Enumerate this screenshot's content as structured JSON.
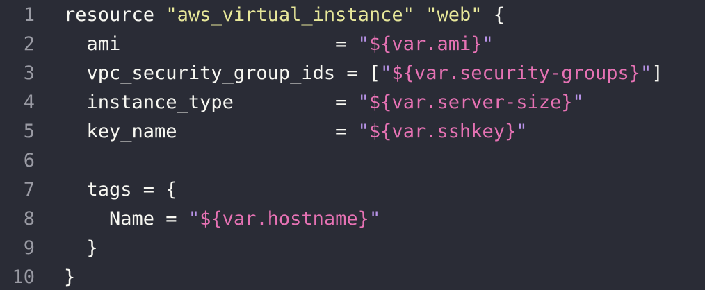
{
  "colors": {
    "background": "#2a2c36",
    "text": "#f8f8f2",
    "line_number": "#9a9ba4",
    "string": "#e8e89a",
    "quote": "#b893e8",
    "interpolation": "#e672b4"
  },
  "lines": [
    {
      "num": "1",
      "indent": "",
      "key": "resource ",
      "rest": [
        {
          "t": "\"aws_virtual_instance\"",
          "c": "s-str"
        },
        {
          "t": " ",
          "c": "s-plain"
        },
        {
          "t": "\"web\"",
          "c": "s-str"
        },
        {
          "t": " {",
          "c": "s-plain"
        }
      ]
    },
    {
      "num": "2",
      "indent": "  ",
      "key": "ami                   = ",
      "rest": [
        {
          "t": "\"",
          "c": "s-quote"
        },
        {
          "t": "${var.ami}",
          "c": "s-interp"
        },
        {
          "t": "\"",
          "c": "s-quote"
        }
      ]
    },
    {
      "num": "3",
      "indent": "  ",
      "key": "vpc_security_group_ids = [",
      "rest": [
        {
          "t": "\"",
          "c": "s-quote"
        },
        {
          "t": "${var.security-groups}",
          "c": "s-interp"
        },
        {
          "t": "\"",
          "c": "s-quote"
        },
        {
          "t": "]",
          "c": "s-plain"
        }
      ]
    },
    {
      "num": "4",
      "indent": "  ",
      "key": "instance_type         = ",
      "rest": [
        {
          "t": "\"",
          "c": "s-quote"
        },
        {
          "t": "${var.server-size}",
          "c": "s-interp"
        },
        {
          "t": "\"",
          "c": "s-quote"
        }
      ]
    },
    {
      "num": "5",
      "indent": "  ",
      "key": "key_name              = ",
      "rest": [
        {
          "t": "\"",
          "c": "s-quote"
        },
        {
          "t": "${var.sshkey}",
          "c": "s-interp"
        },
        {
          "t": "\"",
          "c": "s-quote"
        }
      ]
    },
    {
      "num": "6",
      "indent": "",
      "key": "",
      "rest": []
    },
    {
      "num": "7",
      "indent": "  ",
      "key": "tags = {",
      "rest": []
    },
    {
      "num": "8",
      "indent": "    ",
      "key": "Name = ",
      "rest": [
        {
          "t": "\"",
          "c": "s-quote"
        },
        {
          "t": "${var.hostname}",
          "c": "s-interp"
        },
        {
          "t": "\"",
          "c": "s-quote"
        }
      ]
    },
    {
      "num": "9",
      "indent": "  ",
      "key": "}",
      "rest": []
    },
    {
      "num": "10",
      "indent": "",
      "key": "}",
      "rest": []
    }
  ]
}
